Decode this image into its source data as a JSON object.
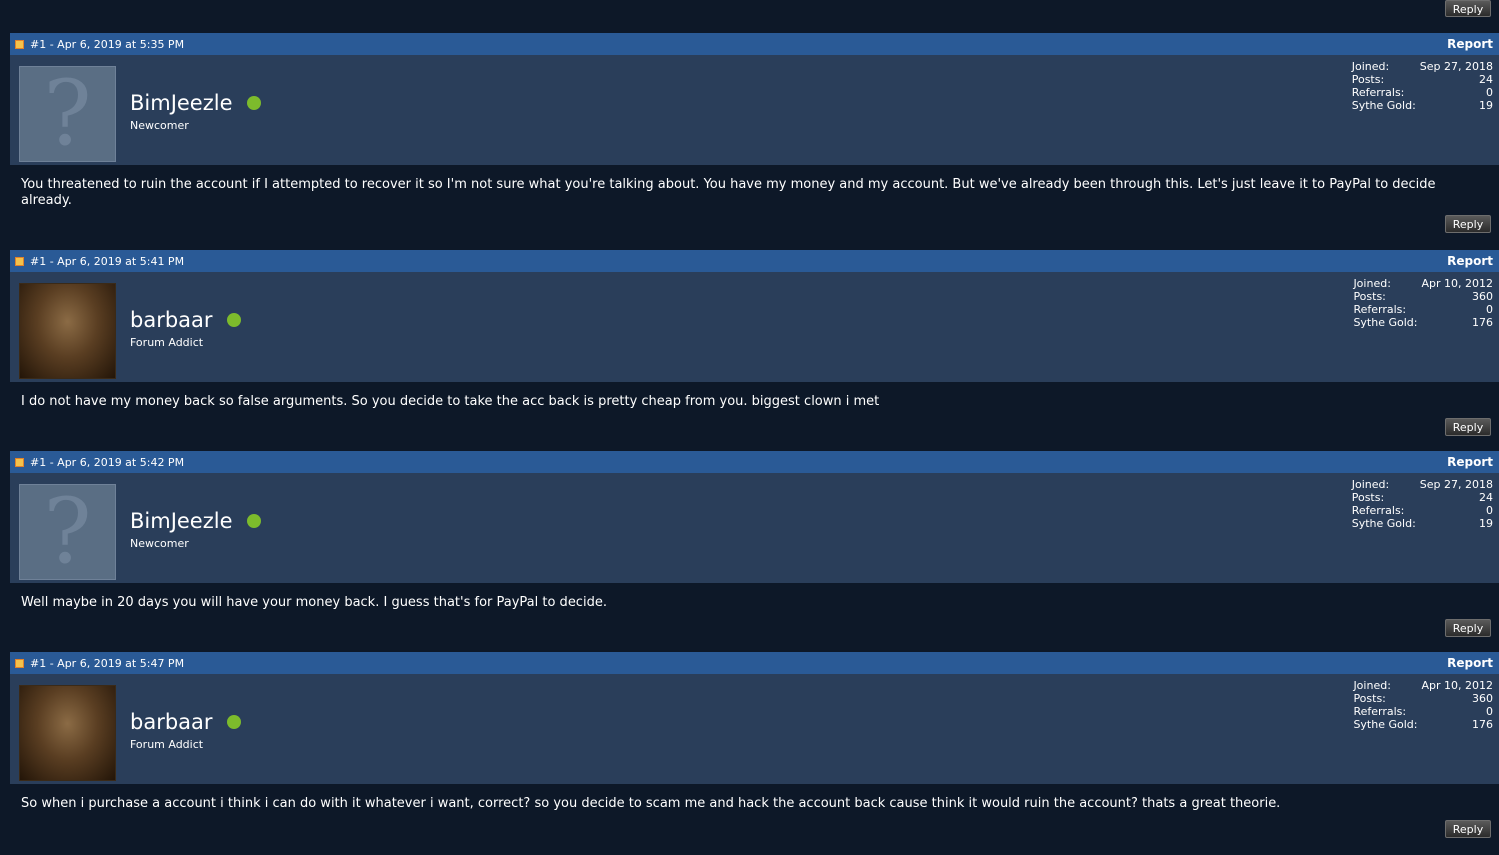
{
  "reply_label": "Reply",
  "report_label": "Report",
  "posts": [
    {
      "meta": "#1 - Apr 6, 2019 at 5:35 PM",
      "username": "BimJeezle",
      "user_title": "Newcomer",
      "avatar": "default-avatar",
      "stats": [
        {
          "label": "Joined:",
          "value": "Sep 27, 2018"
        },
        {
          "label": "Posts:",
          "value": "24"
        },
        {
          "label": "Referrals:",
          "value": "0"
        },
        {
          "label": "Sythe Gold:",
          "value": "19"
        }
      ],
      "message": "You threatened to ruin the account if I attempted to recover it so I'm not sure what you're talking about. You have my money and my account. But we've already been through this. Let's just leave it to PayPal to decide already."
    },
    {
      "meta": "#1 - Apr 6, 2019 at 5:41 PM",
      "username": "barbaar",
      "user_title": "Forum Addict",
      "avatar": "photo-avatar",
      "stats": [
        {
          "label": "Joined:",
          "value": "Apr 10, 2012"
        },
        {
          "label": "Posts:",
          "value": "360"
        },
        {
          "label": "Referrals:",
          "value": "0"
        },
        {
          "label": "Sythe Gold:",
          "value": "176"
        }
      ],
      "message": "I do not have my money back so false arguments. So you decide to take the acc back is pretty cheap from you. biggest clown i met"
    },
    {
      "meta": "#1 - Apr 6, 2019 at 5:42 PM",
      "username": "BimJeezle",
      "user_title": "Newcomer",
      "avatar": "default-avatar",
      "stats": [
        {
          "label": "Joined:",
          "value": "Sep 27, 2018"
        },
        {
          "label": "Posts:",
          "value": "24"
        },
        {
          "label": "Referrals:",
          "value": "0"
        },
        {
          "label": "Sythe Gold:",
          "value": "19"
        }
      ],
      "message": "Well maybe in 20 days you will have your money back. I guess that's for PayPal to decide."
    },
    {
      "meta": "#1 - Apr 6, 2019 at 5:47 PM",
      "username": "barbaar",
      "user_title": "Forum Addict",
      "avatar": "photo-avatar",
      "stats": [
        {
          "label": "Joined:",
          "value": "Apr 10, 2012"
        },
        {
          "label": "Posts:",
          "value": "360"
        },
        {
          "label": "Referrals:",
          "value": "0"
        },
        {
          "label": "Sythe Gold:",
          "value": "176"
        }
      ],
      "message": "So when i purchase a account i think i can do with it whatever i want, correct? so you decide to scam me and hack the account back cause think it would ruin the account? thats a great theorie."
    }
  ]
}
